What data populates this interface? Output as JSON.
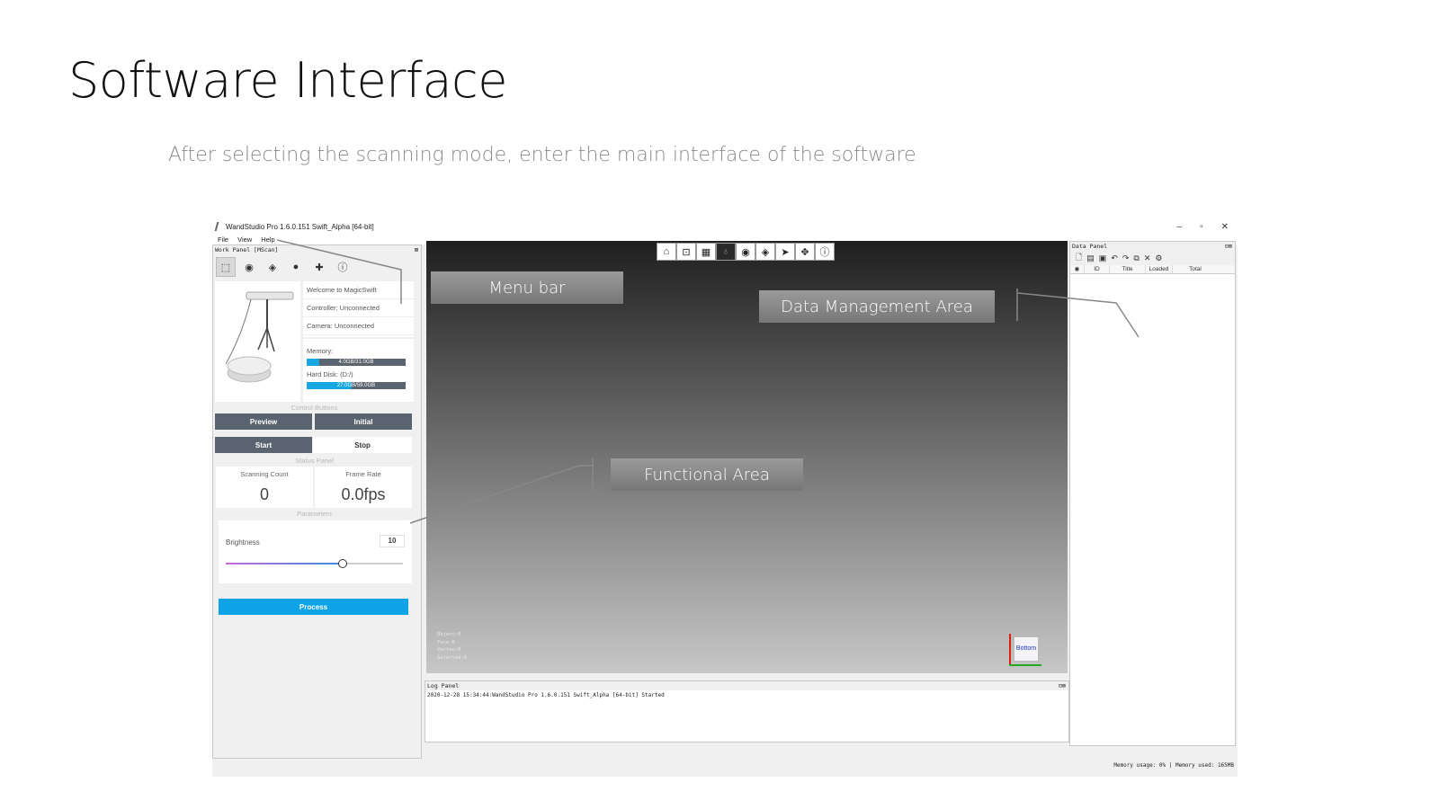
{
  "slide": {
    "title": "Software Interface",
    "subtitle": "After selecting the scanning mode, enter the main interface of the software"
  },
  "window": {
    "title": "WandStudio Pro 1.6.0.151 Swift_Alpha [64-bit]",
    "controls": [
      "–",
      "▫",
      "✕"
    ]
  },
  "menu": [
    "File",
    "View",
    "Help"
  ],
  "work_panel": {
    "title": "Work Panel [MScan]",
    "close_label": "⊠",
    "tool_icons": [
      "cube-icon",
      "eye-icon",
      "box-icon",
      "sphere-icon",
      "puzzle-icon",
      "info-icon"
    ],
    "welcome": "Welcome to MagicSwift",
    "controller": "Controller: Unconnected",
    "camera": "Camera: Unconnected",
    "memory_label": "Memory:",
    "memory_text": "4.0GB/31.0GB",
    "memory_fraction": 0.129,
    "disk_label": "Hard Disk: (D:/)",
    "disk_text": "27.0GB/59.0GB",
    "disk_fraction": 0.458,
    "control_buttons_label": "Control Buttons",
    "preview": "Preview",
    "initial": "Initial",
    "start": "Start",
    "stop": "Stop",
    "status_panel_label": "Status Panel",
    "scanning_count_label": "Scanning Count",
    "scanning_count": "0",
    "frame_rate_label": "Frame Rate",
    "frame_rate": "0.0fps",
    "parameters_label": "Parameters",
    "brightness_label": "Brightness",
    "brightness_value": "10",
    "brightness_fraction": 0.66,
    "process": "Process"
  },
  "viewport": {
    "toolbar_icons": [
      "home-icon",
      "fit-icon",
      "grid-icon",
      "light-icon",
      "eye-icon",
      "layers-icon",
      "pointer-icon",
      "move-icon",
      "info-icon"
    ],
    "stats": [
      "Object:0",
      "Face:0",
      "Vertex:0",
      "Selected:0"
    ],
    "orientation_label": "Bottom"
  },
  "log_panel": {
    "title": "Log Panel",
    "close_label": "⊡⊠",
    "lines": [
      "2020-12-28 15:34:44:WandStudio Pro 1.6.0.151 Swift_Alpha [64-bit] Started"
    ]
  },
  "data_panel": {
    "title": "Data Panel",
    "close_label": "⊡⊠",
    "tool_icons": [
      "new-icon",
      "open-icon",
      "save-icon",
      "undo-icon",
      "redo-icon",
      "copy-icon",
      "delete-icon",
      "settings-icon"
    ],
    "columns": [
      "",
      "ID",
      "Title",
      "Loaded",
      "Total"
    ]
  },
  "status_bar": "Memory usage: 0% | Memory used: 165MB",
  "callouts": {
    "menu_bar": "Menu bar",
    "data_management": "Data Management Area",
    "functional": "Functional Area"
  }
}
